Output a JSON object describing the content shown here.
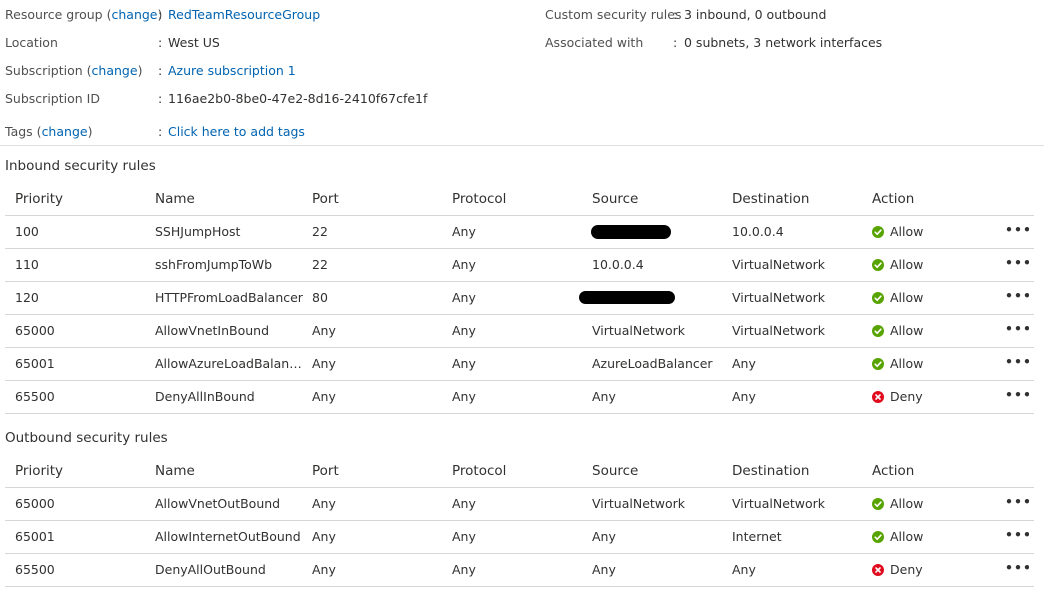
{
  "essentials": {
    "resource_group": {
      "label": "Resource group",
      "change_open": "(",
      "change": "change",
      "change_close": ")",
      "value": "RedTeamResourceGroup"
    },
    "location": {
      "label": "Location",
      "value": "West US"
    },
    "subscription": {
      "label": "Subscription",
      "change_open": "(",
      "change": "change",
      "change_close": ")",
      "value": "Azure subscription 1"
    },
    "subscription_id": {
      "label": "Subscription ID",
      "value": "116ae2b0-8be0-47e2-8d16-2410f67cfe1f"
    },
    "tags": {
      "label": "Tags",
      "change_open": "(",
      "change": "change",
      "change_close": ")",
      "value": "Click here to add tags"
    },
    "custom_rules": {
      "label": "Custom security rules",
      "value": "3 inbound, 0 outbound"
    },
    "associated_with": {
      "label": "Associated with",
      "value": "0 subnets, 3 network interfaces"
    },
    "colon": ":"
  },
  "columns": {
    "priority": "Priority",
    "name": "Name",
    "port": "Port",
    "protocol": "Protocol",
    "source": "Source",
    "destination": "Destination",
    "action": "Action"
  },
  "inbound": {
    "title": "Inbound security rules",
    "rows": [
      {
        "priority": "100",
        "name": "SSHJumpHost",
        "port": "22",
        "protocol": "Any",
        "source": "",
        "destination": "10.0.0.4",
        "action": "Allow"
      },
      {
        "priority": "110",
        "name": "sshFromJumpToWb",
        "port": "22",
        "protocol": "Any",
        "source": "10.0.0.4",
        "destination": "VirtualNetwork",
        "action": "Allow"
      },
      {
        "priority": "120",
        "name": "HTTPFromLoadBalancer",
        "port": "80",
        "protocol": "Any",
        "source": "",
        "destination": "VirtualNetwork",
        "action": "Allow"
      },
      {
        "priority": "65000",
        "name": "AllowVnetInBound",
        "port": "Any",
        "protocol": "Any",
        "source": "VirtualNetwork",
        "destination": "VirtualNetwork",
        "action": "Allow"
      },
      {
        "priority": "65001",
        "name": "AllowAzureLoadBalance...",
        "port": "Any",
        "protocol": "Any",
        "source": "AzureLoadBalancer",
        "destination": "Any",
        "action": "Allow"
      },
      {
        "priority": "65500",
        "name": "DenyAllInBound",
        "port": "Any",
        "protocol": "Any",
        "source": "Any",
        "destination": "Any",
        "action": "Deny"
      }
    ]
  },
  "outbound": {
    "title": "Outbound security rules",
    "rows": [
      {
        "priority": "65000",
        "name": "AllowVnetOutBound",
        "port": "Any",
        "protocol": "Any",
        "source": "VirtualNetwork",
        "destination": "VirtualNetwork",
        "action": "Allow"
      },
      {
        "priority": "65001",
        "name": "AllowInternetOutBound",
        "port": "Any",
        "protocol": "Any",
        "source": "Any",
        "destination": "Internet",
        "action": "Allow"
      },
      {
        "priority": "65500",
        "name": "DenyAllOutBound",
        "port": "Any",
        "protocol": "Any",
        "source": "Any",
        "destination": "Any",
        "action": "Deny"
      }
    ]
  },
  "more_icon": "ellipsis-icon",
  "colors": {
    "link": "#0063b1",
    "allow": "#57a300",
    "deny": "#e00b1c",
    "redaction": "#000000"
  }
}
